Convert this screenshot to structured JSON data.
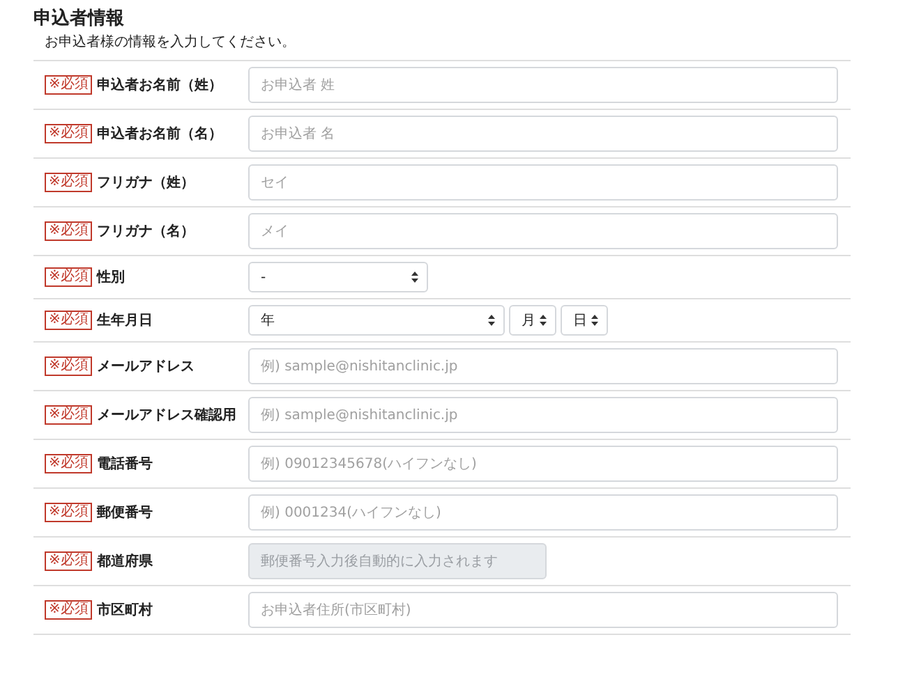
{
  "section": {
    "title": "申込者情報",
    "description": "お申込者様の情報を入力してください。"
  },
  "fields": [
    {
      "kind": "text",
      "badge": "※必須",
      "label": "申込者お名前（姓）",
      "placeholder": "お申込者 姓",
      "disabled": false
    },
    {
      "kind": "text",
      "badge": "※必須",
      "label": "申込者お名前（名）",
      "placeholder": "お申込者 名",
      "disabled": false
    },
    {
      "kind": "text",
      "badge": "※必須",
      "label": "フリガナ（姓）",
      "placeholder": "セイ",
      "disabled": false
    },
    {
      "kind": "text",
      "badge": "※必須",
      "label": "フリガナ（名）",
      "placeholder": "メイ",
      "disabled": false
    },
    {
      "kind": "select",
      "badge": "※必須",
      "label": "性別",
      "value": "-"
    },
    {
      "kind": "date",
      "badge": "※必須",
      "label": "生年月日",
      "selects": [
        {
          "value": "年"
        },
        {
          "value": "月"
        },
        {
          "value": "日"
        }
      ]
    },
    {
      "kind": "text",
      "badge": "※必須",
      "label": "メールアドレス",
      "placeholder": "例) sample@nishitanclinic.jp",
      "disabled": false
    },
    {
      "kind": "text",
      "badge": "※必須",
      "label": "メールアドレス確認用",
      "placeholder": "例) sample@nishitanclinic.jp",
      "disabled": false
    },
    {
      "kind": "text",
      "badge": "※必須",
      "label": "電話番号",
      "placeholder": "例) 09012345678(ハイフンなし)",
      "disabled": false
    },
    {
      "kind": "text",
      "badge": "※必須",
      "label": "郵便番号",
      "placeholder": "例) 0001234(ハイフンなし)",
      "disabled": false
    },
    {
      "kind": "text",
      "badge": "※必須",
      "label": "都道府県",
      "placeholder": "郵便番号入力後自動的に入力されます",
      "disabled": true
    },
    {
      "kind": "text",
      "badge": "※必須",
      "label": "市区町村",
      "placeholder": "お申込者住所(市区町村)",
      "disabled": false
    }
  ]
}
